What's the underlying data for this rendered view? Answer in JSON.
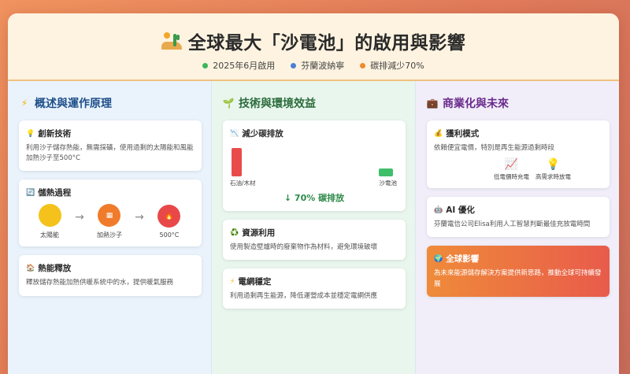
{
  "header": {
    "title": "全球最大「沙電池」的啟用與影響",
    "meta": [
      {
        "label": "2025年6月啟用",
        "color": "#3cb55a"
      },
      {
        "label": "芬蘭波納寧",
        "color": "#4a7fd8"
      },
      {
        "label": "碳排減少70%",
        "color": "#ef8a2e"
      }
    ]
  },
  "col1": {
    "title": "概述與運作原理",
    "card1": {
      "title": "創新技術",
      "text": "利用沙子儲存熱能，無需採礦，使用過剩的太陽能和風能加熱沙子至500°C"
    },
    "card2": {
      "title": "儲熱過程",
      "steps": [
        "太陽能",
        "加熱沙子",
        "500°C"
      ]
    },
    "card3": {
      "title": "熱能釋放",
      "text": "釋放儲存熱能加熱供暖系統中的水，提供暖氣服務"
    }
  },
  "col2": {
    "title": "技術與環境效益",
    "card1": {
      "title": "減少碳排放",
      "label_left": "石油/木材",
      "label_right": "沙電池",
      "reduce": "↓ 70% 碳排放"
    },
    "card2": {
      "title": "資源利用",
      "text": "使用製造壁爐時的廢棄物作為材料，避免環境破壞"
    },
    "card3": {
      "title": "電網穩定",
      "text": "利用過剩再生能源，降低運營成本並穩定電網供應"
    }
  },
  "col3": {
    "title": "商業化與未來",
    "card1": {
      "title": "獲利模式",
      "text": "依賴便宜電價，特別是再生能源過剩時段",
      "items": [
        "低電價時充電",
        "高需求時放電"
      ]
    },
    "card2": {
      "title": "AI 優化",
      "text": "芬蘭電信公司Elisa利用人工智慧判斷最佳充放電時間"
    },
    "card3": {
      "title": "全球影響",
      "text": "為未來能源儲存解決方案提供新思路，推動全球可持續發展"
    }
  }
}
